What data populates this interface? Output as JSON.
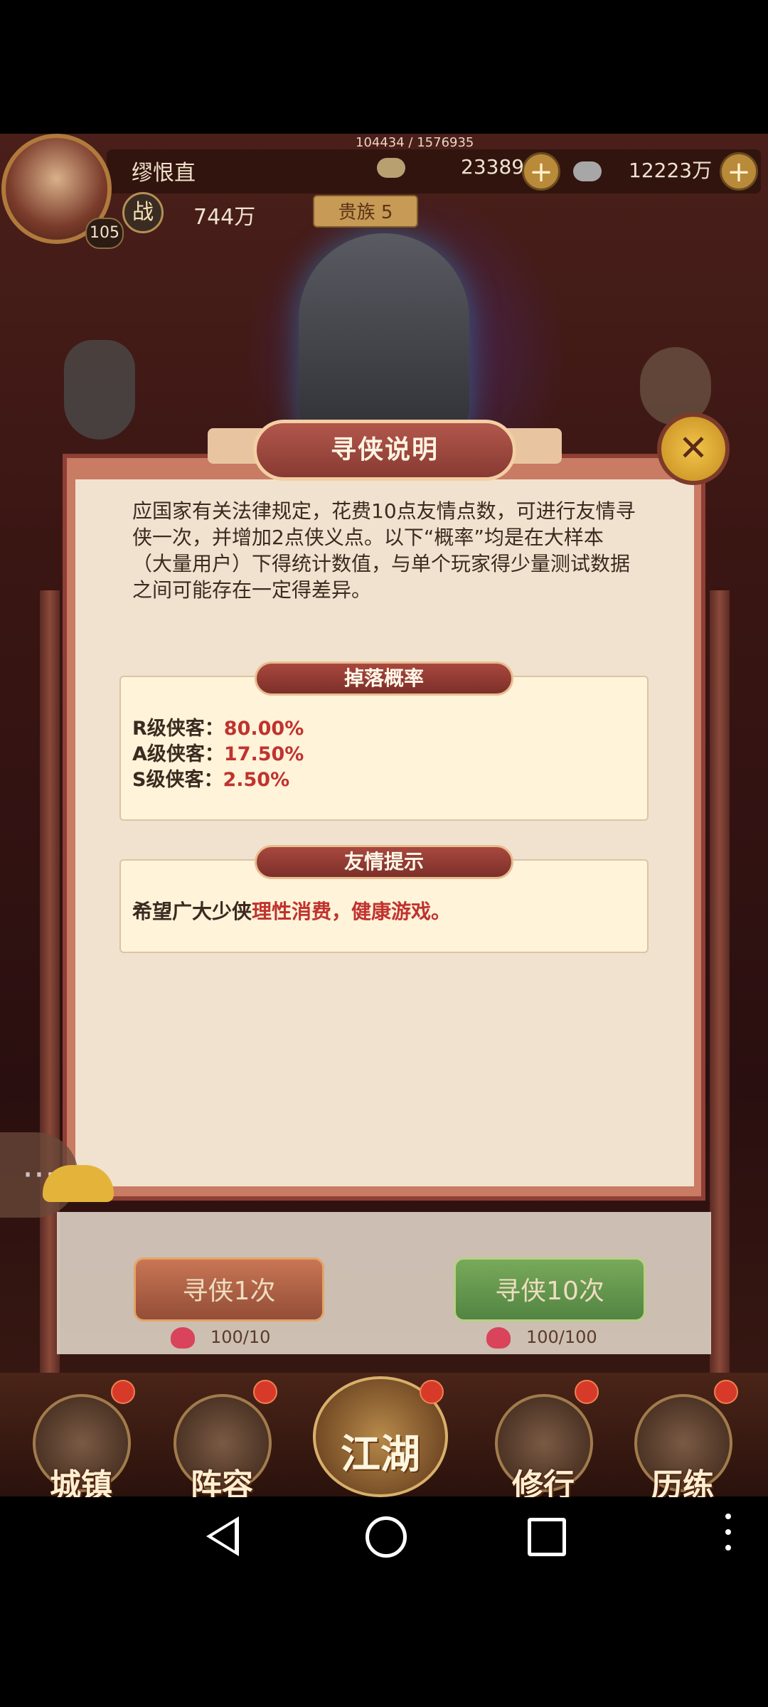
{
  "hud": {
    "exp": "104434 / 1576935",
    "player_name": "缪恨直",
    "level": "105",
    "gold": "23389",
    "silver": "12223万",
    "power_icon": "战",
    "power": "744万",
    "rank": "贵族 5"
  },
  "dialog": {
    "title": "寻侠说明",
    "intro": "应国家有关法律规定，花费10点友情点数，可进行友情寻侠一次，并增加2点侠义点。以下“概率”均是在大样本（大量用户）下得统计数值，与单个玩家得少量测试数据之间可能存在一定得差异。",
    "drop_tab": "掉落概率",
    "rates": [
      {
        "label": "R级侠客：",
        "value": "80.00%"
      },
      {
        "label": "A级侠客：",
        "value": "17.50%"
      },
      {
        "label": "S级侠客：",
        "value": "2.50%"
      }
    ],
    "tip_tab": "友情提示",
    "tip_prefix": "希望广大少侠",
    "tip_highlight": "理性消费，健康游戏。"
  },
  "recruit": {
    "btn_once": "寻侠1次",
    "btn_ten": "寻侠10次",
    "cost_once": "100/10",
    "cost_ten": "100/100"
  },
  "nav": {
    "items": [
      "城镇",
      "阵容",
      "江湖",
      "修行",
      "历练"
    ]
  },
  "colors": {
    "accent_red": "#c0332f",
    "panel_bg": "#fff3d9",
    "dialog_border": "#8f3f35"
  }
}
